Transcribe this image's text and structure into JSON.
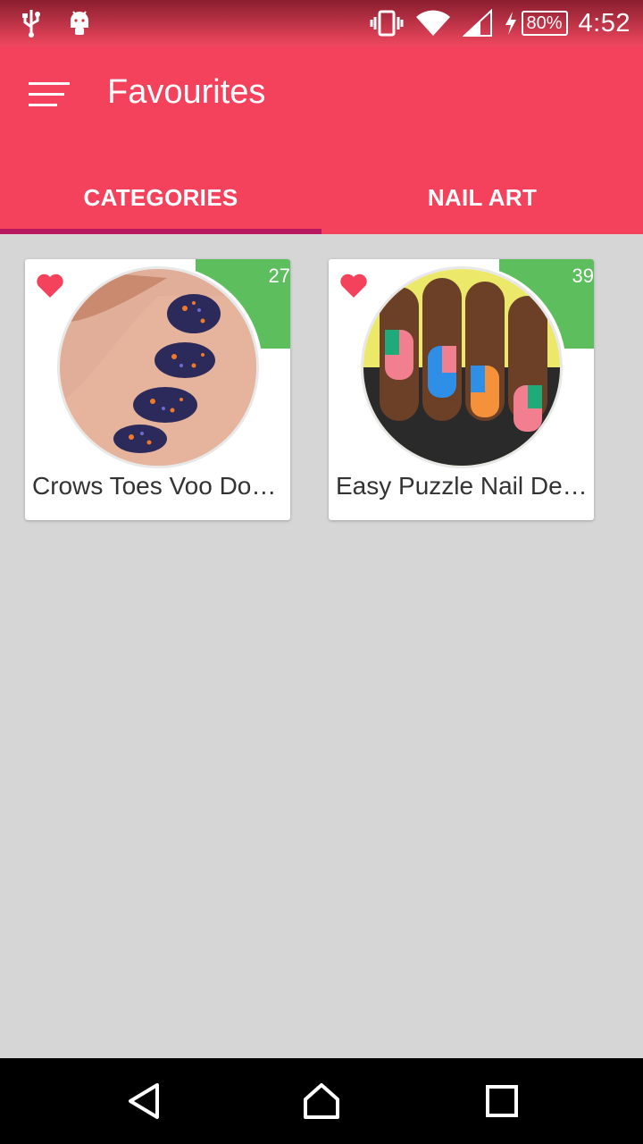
{
  "status_bar": {
    "time": "4:52",
    "battery": "80%",
    "icons": [
      "usb-icon",
      "android-icon",
      "vibrate-icon",
      "wifi-icon",
      "signal-icon",
      "charging-icon"
    ]
  },
  "app_bar": {
    "title": "Favourites",
    "menu_icon": "hamburger-icon",
    "color": "#f4415c"
  },
  "tabs": [
    {
      "label": "CATEGORIES",
      "active": true
    },
    {
      "label": "NAIL ART",
      "active": false
    }
  ],
  "cards": [
    {
      "title": "Crows Toes Voo Doo Nails",
      "count": "27",
      "favourite": true
    },
    {
      "title": "Easy Puzzle Nail Design",
      "count": "39",
      "favourite": true
    }
  ],
  "nav_bar": {
    "icons": [
      "back-icon",
      "home-icon",
      "recents-icon"
    ]
  },
  "colors": {
    "accent": "#f4415c",
    "tab_indicator": "#b8185f",
    "badge": "#5cbe5c",
    "heart": "#f4415c",
    "background": "#d6d6d6"
  }
}
